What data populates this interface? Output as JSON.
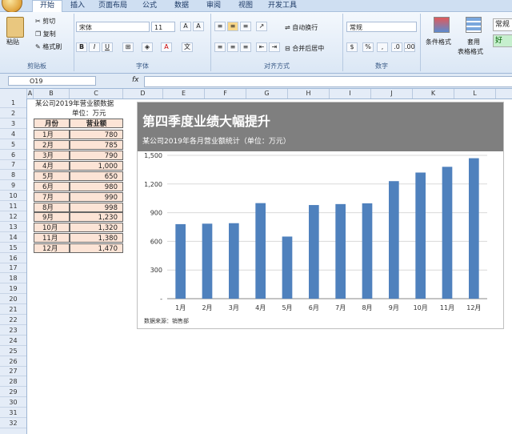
{
  "ribbon": {
    "tabs": [
      "开始",
      "插入",
      "页面布局",
      "公式",
      "数据",
      "审阅",
      "视图",
      "开发工具"
    ],
    "clipboard": {
      "paste": "粘贴",
      "cut": "剪切",
      "copy": "复制",
      "format_painter": "格式刷",
      "label": "剪贴板"
    },
    "font": {
      "name": "宋体",
      "size": "11",
      "label": "字体"
    },
    "alignment": {
      "wrap": "自动换行",
      "merge": "合并后居中",
      "label": "对齐方式"
    },
    "number": {
      "format": "常规",
      "label": "数字"
    },
    "styles": {
      "conditional": "条件格式",
      "table": "套用",
      "table2": "表格格式",
      "good": "好",
      "normal": "常规"
    }
  },
  "formula_bar": {
    "name_box": "O19",
    "fx": "fx",
    "content": ""
  },
  "columns": [
    "A",
    "B",
    "C",
    "D",
    "E",
    "F",
    "G",
    "H",
    "I",
    "J",
    "K",
    "L"
  ],
  "rows": [
    "1",
    "2",
    "3",
    "4",
    "5",
    "6",
    "7",
    "8",
    "9",
    "10",
    "11",
    "12",
    "13",
    "14",
    "15",
    "16",
    "17",
    "18",
    "19",
    "20",
    "21",
    "22",
    "23",
    "24",
    "25",
    "26",
    "27",
    "28",
    "29",
    "30",
    "31",
    "32"
  ],
  "sheet": {
    "title": "某公司2019年营业额数据",
    "unit": "单位：万元",
    "headers": [
      "月份",
      "营业额"
    ],
    "months": [
      "1月",
      "2月",
      "3月",
      "4月",
      "5月",
      "6月",
      "7月",
      "8月",
      "9月",
      "10月",
      "11月",
      "12月"
    ],
    "values": [
      "780",
      "785",
      "790",
      "1,000",
      "650",
      "980",
      "990",
      "998",
      "1,230",
      "1,320",
      "1,380",
      "1,470"
    ]
  },
  "chart_data": {
    "type": "bar",
    "title": "第四季度业绩大幅提升",
    "subtitle": "某公司2019年各月营业额统计（单位：万元）",
    "categories": [
      "1月",
      "2月",
      "3月",
      "4月",
      "5月",
      "6月",
      "7月",
      "8月",
      "9月",
      "10月",
      "11月",
      "12月"
    ],
    "values": [
      780,
      785,
      790,
      1000,
      650,
      980,
      990,
      998,
      1230,
      1320,
      1380,
      1470
    ],
    "ylim": [
      0,
      1500
    ],
    "yticks": [
      "-",
      "300",
      "600",
      "900",
      "1,200",
      "1,500"
    ],
    "grid": true,
    "note": "数据来源：销售部",
    "bar_color": "#4f81bd"
  }
}
